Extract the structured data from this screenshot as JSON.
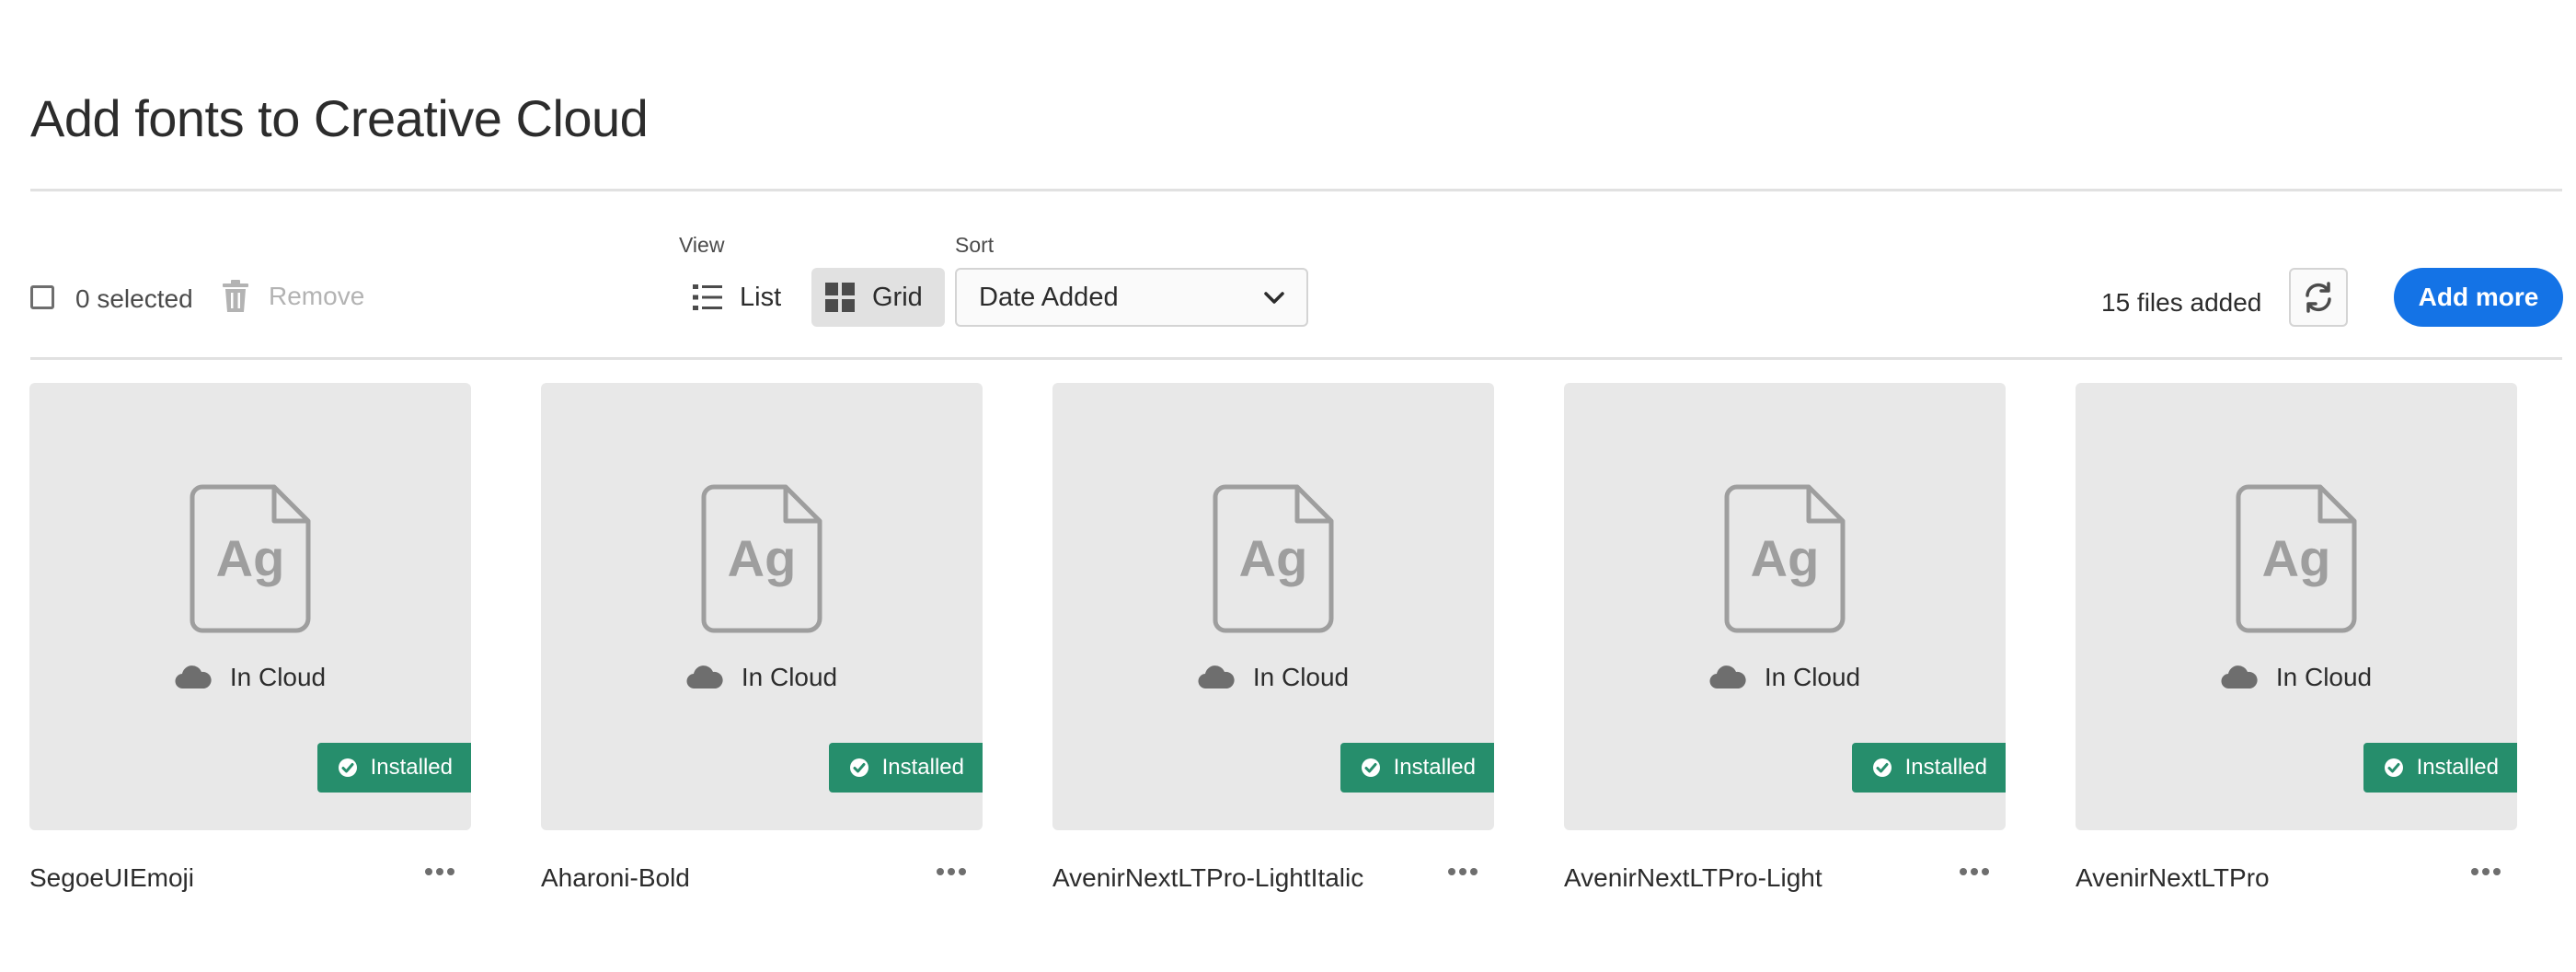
{
  "page": {
    "title": "Add fonts to Creative Cloud"
  },
  "toolbar": {
    "selected_label": "0 selected",
    "remove_label": "Remove",
    "view_label": "View",
    "view_list_label": "List",
    "view_grid_label": "Grid",
    "active_view": "Grid",
    "sort_label": "Sort",
    "sort_value": "Date Added",
    "files_count_label": "15 files added",
    "add_more_label": "Add more"
  },
  "colors": {
    "accent": "#1473e6",
    "installed": "#268e6c",
    "card_bg": "#e8e8e8",
    "icon_gray": "#9e9e9e"
  },
  "icons": {
    "checkbox": "checkbox-icon",
    "remove": "trash-icon",
    "list": "list-view-icon",
    "grid": "grid-view-icon",
    "sort": "chevron-down-icon",
    "refresh": "refresh-icon",
    "file": "font-file-icon",
    "cloud": "cloud-icon",
    "installed": "checkmark-circle-icon",
    "more": "more-icon"
  },
  "font_icon_text": "Ag",
  "fonts": [
    {
      "name": "SegoeUIEmoji",
      "status": "In Cloud",
      "badge": "Installed"
    },
    {
      "name": "Aharoni-Bold",
      "status": "In Cloud",
      "badge": "Installed"
    },
    {
      "name": "AvenirNextLTPro-LightItalic",
      "status": "In Cloud",
      "badge": "Installed"
    },
    {
      "name": "AvenirNextLTPro-Light",
      "status": "In Cloud",
      "badge": "Installed"
    },
    {
      "name": "AvenirNextLTPro",
      "status": "In Cloud",
      "badge": "Installed"
    }
  ]
}
